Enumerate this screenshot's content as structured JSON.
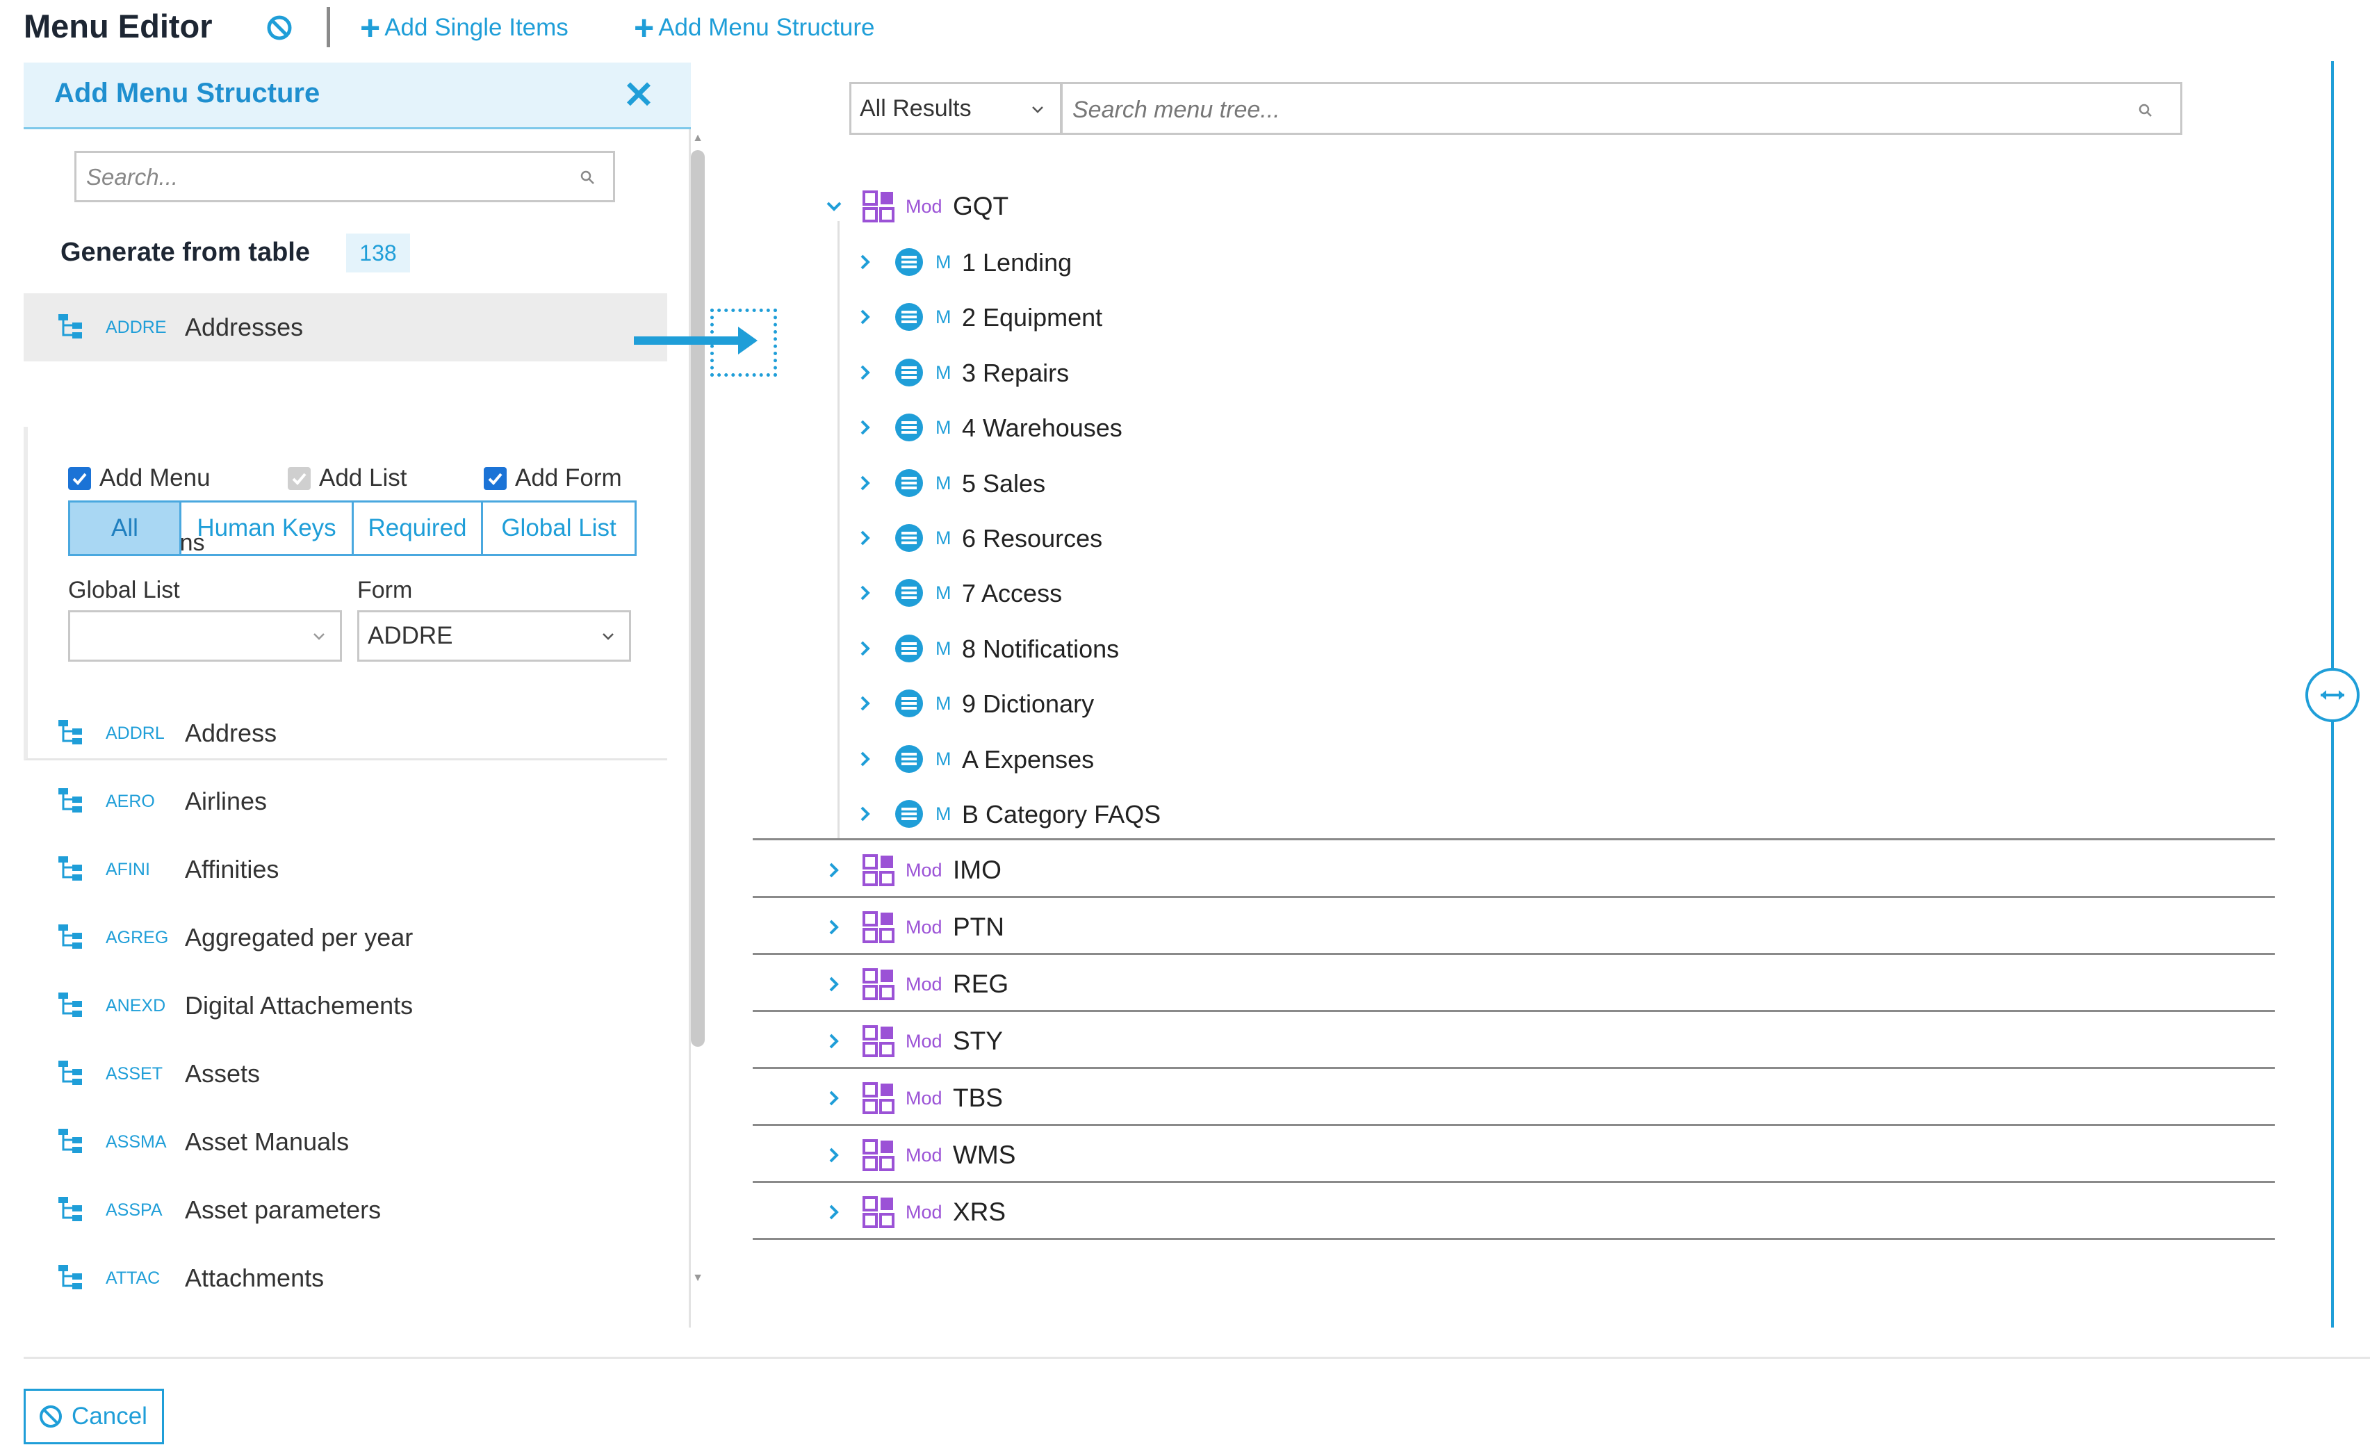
{
  "header": {
    "title": "Menu Editor",
    "add_single_items": "Add Single Items",
    "add_menu_structure": "Add Menu Structure"
  },
  "left_panel": {
    "title": "Add Menu Structure",
    "search_placeholder": "Search...",
    "generate_label": "Generate from table",
    "generate_count": "138",
    "selected_table": {
      "code": "ADDRE",
      "name": "Addresses"
    },
    "options": {
      "add_menu": "Add Menu",
      "add_list": "Add List",
      "add_form": "Add Form",
      "add_menu_checked": true,
      "add_list_checked": true,
      "add_form_checked": true
    },
    "list_columns_label": "List Columns",
    "list_columns_buttons": [
      "All",
      "Human Keys",
      "Required",
      "Global List"
    ],
    "list_columns_active": "All",
    "global_list_label": "Global List",
    "global_list_value": "",
    "form_label": "Form",
    "form_value": "ADDRE",
    "tables": [
      {
        "code": "ADDRL",
        "name": "Address"
      },
      {
        "code": "AERO",
        "name": "Airlines"
      },
      {
        "code": "AFINI",
        "name": "Affinities"
      },
      {
        "code": "AGREG",
        "name": "Aggregated per year"
      },
      {
        "code": "ANEXD",
        "name": "Digital Attachements"
      },
      {
        "code": "ASSET",
        "name": "Assets"
      },
      {
        "code": "ASSMA",
        "name": "Asset Manuals"
      },
      {
        "code": "ASSPA",
        "name": "Asset parameters"
      },
      {
        "code": "ATTAC",
        "name": "Attachments"
      }
    ]
  },
  "tree": {
    "filter_value": "All Results",
    "search_placeholder": "Search menu tree...",
    "mod_tag": "Mod",
    "menu_tag": "M",
    "expanded_module": "GQT",
    "menus": [
      "1 Lending",
      "2 Equipment",
      "3 Repairs",
      "4 Warehouses",
      "5 Sales",
      "6 Resources",
      "7 Access",
      "8 Notifications",
      "9 Dictionary",
      "A Expenses",
      "B Category FAQS"
    ],
    "collapsed_modules": [
      "IMO",
      "PTN",
      "REG",
      "STY",
      "TBS",
      "WMS",
      "XRS"
    ]
  },
  "footer": {
    "cancel_label": "Cancel"
  },
  "colors": {
    "accent": "#1f9ed8",
    "module_purple": "#9b52d6",
    "checkbox_blue": "#1b73d6"
  },
  "icons": [
    "ban-icon",
    "plus-icon",
    "close-icon",
    "search-icon",
    "table-tree-icon",
    "chevron-down-icon",
    "chevron-right-icon",
    "module-grid-icon",
    "menu-list-icon",
    "resize-handle-icon",
    "arrow-right-icon"
  ]
}
